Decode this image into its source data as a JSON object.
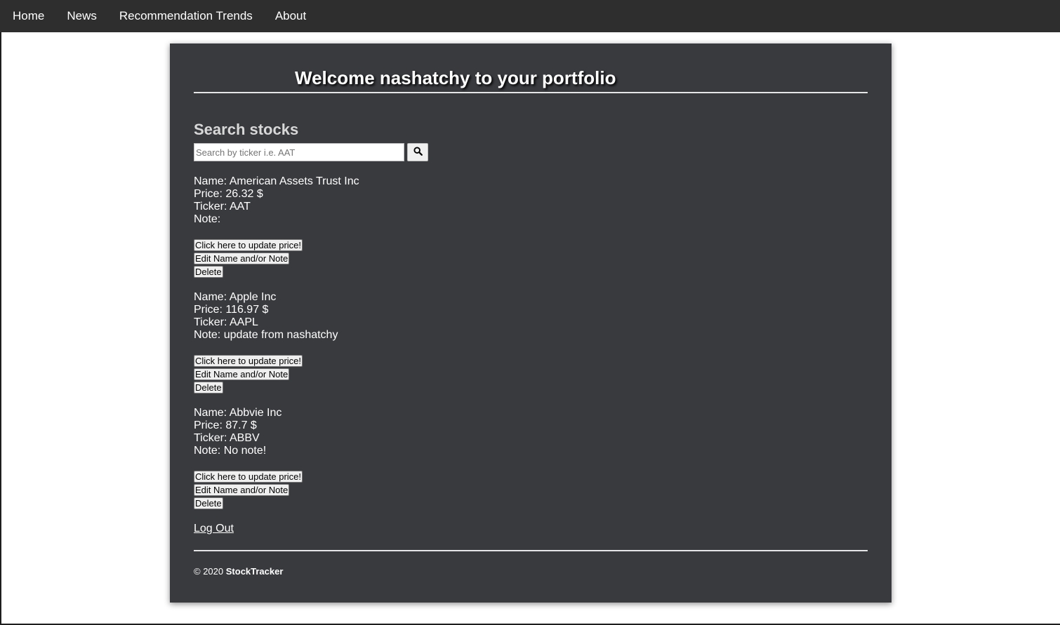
{
  "nav": {
    "items": [
      {
        "label": "Home"
      },
      {
        "label": "News"
      },
      {
        "label": "Recommendation Trends"
      },
      {
        "label": "About"
      }
    ]
  },
  "header": {
    "welcome": "Welcome nashatchy to your portfolio"
  },
  "search": {
    "heading": "Search stocks",
    "placeholder": "Search by ticker i.e. AAT",
    "value": "",
    "button_icon": "search-icon"
  },
  "stocks": [
    {
      "name_line": "Name: American Assets Trust Inc",
      "price_line": "Price: 26.32 $",
      "ticker_line": "Ticker: AAT",
      "note_line": "Note:",
      "update_label": "Click here to update price!",
      "edit_label": "Edit Name and/or Note",
      "delete_label": "Delete"
    },
    {
      "name_line": "Name: Apple Inc",
      "price_line": "Price: 116.97 $",
      "ticker_line": "Ticker: AAPL",
      "note_line": "Note: update from nashatchy",
      "update_label": "Click here to update price!",
      "edit_label": "Edit Name and/or Note",
      "delete_label": "Delete"
    },
    {
      "name_line": "Name: Abbvie Inc",
      "price_line": "Price: 87.7 $",
      "ticker_line": "Ticker: ABBV",
      "note_line": "Note: No note!",
      "update_label": "Click here to update price!",
      "edit_label": "Edit Name and/or Note",
      "delete_label": "Delete"
    }
  ],
  "logout": {
    "label": "Log Out"
  },
  "footer": {
    "copyright": "© 2020",
    "brand": "StockTracker"
  },
  "colors": {
    "nav_bg": "#2e2e2e",
    "card_bg": "#393a3e",
    "text": "#ffffff"
  }
}
